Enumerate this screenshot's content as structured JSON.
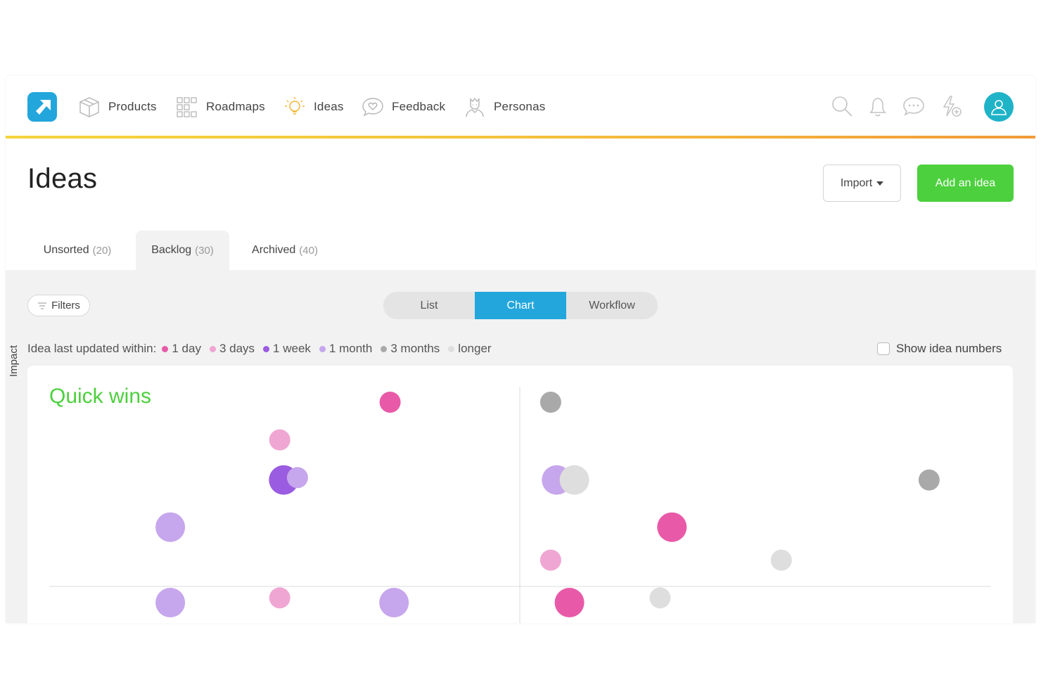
{
  "nav": {
    "items": [
      {
        "label": "Products",
        "icon": "box-icon"
      },
      {
        "label": "Roadmaps",
        "icon": "grid-icon"
      },
      {
        "label": "Ideas",
        "icon": "lightbulb-icon"
      },
      {
        "label": "Feedback",
        "icon": "heart-chat-icon"
      },
      {
        "label": "Personas",
        "icon": "persona-icon"
      }
    ],
    "right_icons": [
      "search-icon",
      "bell-icon",
      "chat-icon",
      "lightning-plus-icon"
    ],
    "accent_colors": [
      "#f5d43c",
      "#f29a3a"
    ],
    "logo_color": "#23a6dc",
    "avatar_color": "#1fb3c8"
  },
  "page": {
    "title": "Ideas",
    "import_label": "Import",
    "add_label": "Add an idea",
    "add_color": "#4cd03d"
  },
  "tabs": [
    {
      "label": "Unsorted",
      "count": "(20)",
      "active": false
    },
    {
      "label": "Backlog",
      "count": "(30)",
      "active": true
    },
    {
      "label": "Archived",
      "count": "(40)",
      "active": false
    }
  ],
  "toolbar": {
    "filters_label": "Filters",
    "views": [
      {
        "label": "List",
        "active": false
      },
      {
        "label": "Chart",
        "active": true
      },
      {
        "label": "Workflow",
        "active": false
      }
    ]
  },
  "legend": {
    "lead": "Idea last updated within:",
    "items": [
      {
        "label": "1 day",
        "color": "#e85aa8"
      },
      {
        "label": "3 days",
        "color": "#f0a6d2"
      },
      {
        "label": "1 week",
        "color": "#9a5ce0"
      },
      {
        "label": "1 month",
        "color": "#c6a6ec"
      },
      {
        "label": "3 months",
        "color": "#a9a9a9"
      },
      {
        "label": "longer",
        "color": "#dedede"
      }
    ],
    "show_numbers_label": "Show idea numbers"
  },
  "chart": {
    "quadrant_label": "Quadrant label: Quick wins",
    "y_axis_label": "Impact"
  },
  "chart_data": {
    "type": "scatter",
    "title": "",
    "xlabel": "",
    "ylabel": "Impact",
    "grid": false,
    "points": [
      {
        "x": 0.368,
        "y": 0.96,
        "size": "s",
        "bucket": "1 day"
      },
      {
        "x": 0.531,
        "y": 0.96,
        "size": "s",
        "bucket": "3 months"
      },
      {
        "x": 0.256,
        "y": 0.8,
        "size": "s",
        "bucket": "3 days"
      },
      {
        "x": 0.26,
        "y": 0.63,
        "size": "m",
        "bucket": "1 week"
      },
      {
        "x": 0.274,
        "y": 0.64,
        "size": "s",
        "bucket": "1 month"
      },
      {
        "x": 0.537,
        "y": 0.63,
        "size": "m",
        "bucket": "1 month"
      },
      {
        "x": 0.555,
        "y": 0.63,
        "size": "m",
        "bucket": "longer"
      },
      {
        "x": 0.915,
        "y": 0.63,
        "size": "s",
        "bucket": "3 months"
      },
      {
        "x": 0.145,
        "y": 0.43,
        "size": "m",
        "bucket": "1 month"
      },
      {
        "x": 0.654,
        "y": 0.43,
        "size": "m",
        "bucket": "1 day"
      },
      {
        "x": 0.531,
        "y": 0.29,
        "size": "s",
        "bucket": "3 days"
      },
      {
        "x": 0.765,
        "y": 0.29,
        "size": "s",
        "bucket": "longer"
      },
      {
        "x": 0.145,
        "y": 0.11,
        "size": "m",
        "bucket": "1 month"
      },
      {
        "x": 0.256,
        "y": 0.13,
        "size": "s",
        "bucket": "3 days"
      },
      {
        "x": 0.372,
        "y": 0.11,
        "size": "m",
        "bucket": "1 month"
      },
      {
        "x": 0.55,
        "y": 0.11,
        "size": "m",
        "bucket": "1 day"
      },
      {
        "x": 0.642,
        "y": 0.13,
        "size": "s",
        "bucket": "longer"
      }
    ]
  }
}
